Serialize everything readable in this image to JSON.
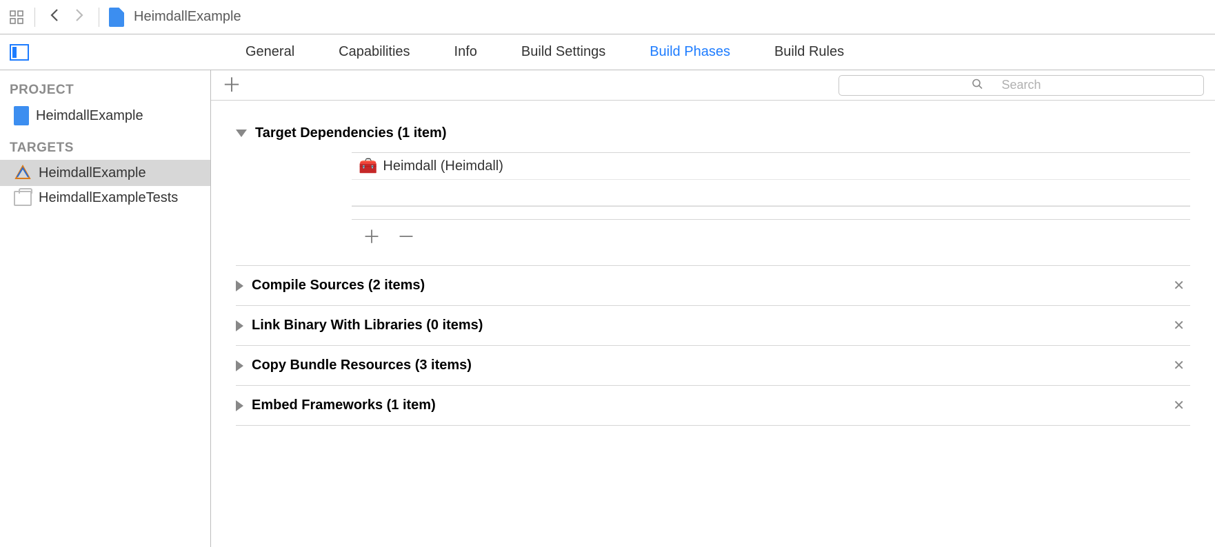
{
  "breadcrumb": {
    "title": "HeimdallExample"
  },
  "tabs": {
    "general": "General",
    "capabilities": "Capabilities",
    "info": "Info",
    "build_settings": "Build Settings",
    "build_phases": "Build Phases",
    "build_rules": "Build Rules"
  },
  "sidebar": {
    "project_header": "PROJECT",
    "project_name": "HeimdallExample",
    "targets_header": "TARGETS",
    "targets": [
      {
        "name": "HeimdallExample",
        "selected": true
      },
      {
        "name": "HeimdallExampleTests",
        "selected": false
      }
    ]
  },
  "search": {
    "placeholder": "Search"
  },
  "phases": {
    "target_dependencies": {
      "title": "Target Dependencies (1 item)",
      "items": [
        {
          "label": "Heimdall (Heimdall)"
        }
      ]
    },
    "compile_sources": {
      "title": "Compile Sources (2 items)"
    },
    "link_binary": {
      "title": "Link Binary With Libraries (0 items)"
    },
    "copy_bundle": {
      "title": "Copy Bundle Resources (3 items)"
    },
    "embed_frameworks": {
      "title": "Embed Frameworks (1 item)"
    }
  }
}
